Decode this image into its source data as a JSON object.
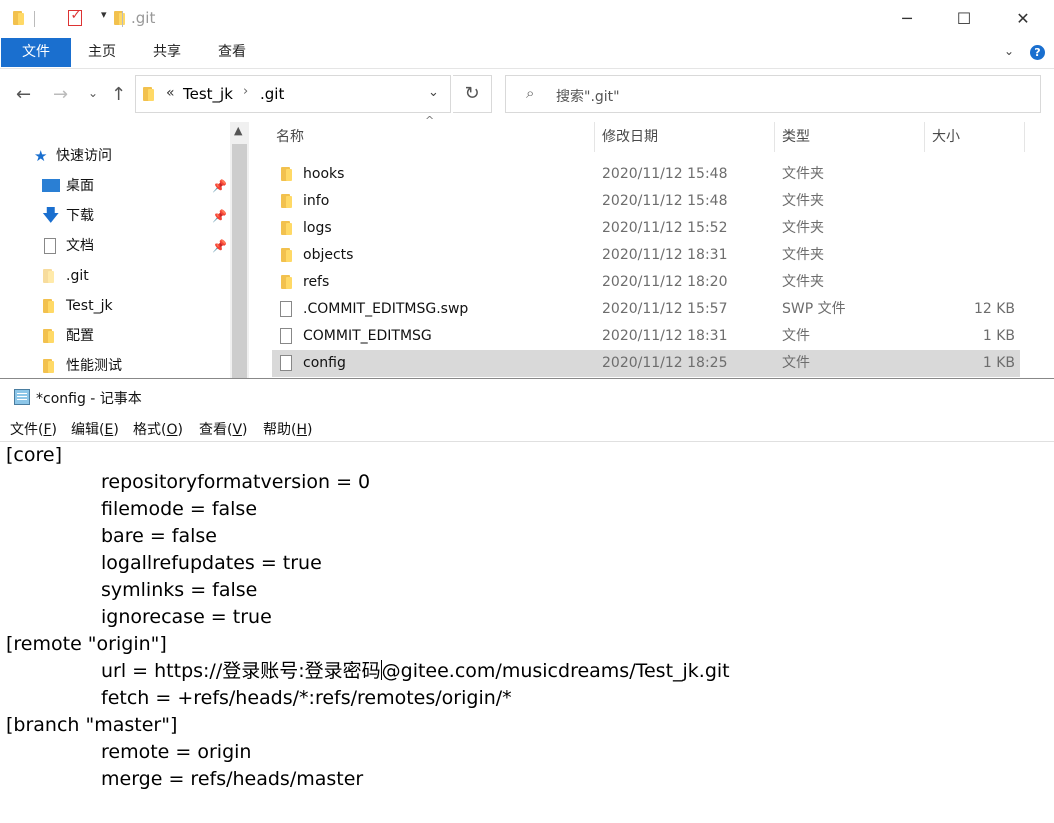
{
  "explorer": {
    "title": ".git",
    "ribbon_tabs": [
      "文件",
      "主页",
      "共享",
      "查看"
    ],
    "breadcrumb": {
      "root_chevron": "«",
      "items": [
        "Test_jk",
        ".git"
      ]
    },
    "search_placeholder": "搜索\".git\"",
    "nav": [
      {
        "label": "快速访问",
        "icon": "star-icon",
        "pinned": false
      },
      {
        "label": "桌面",
        "icon": "desktop-icon",
        "pinned": true
      },
      {
        "label": "下载",
        "icon": "download-arrow-icon",
        "pinned": true
      },
      {
        "label": "文档",
        "icon": "document-icon",
        "pinned": true
      },
      {
        "label": ".git",
        "icon": "folder-icon",
        "pinned": false
      },
      {
        "label": "Test_jk",
        "icon": "folder-icon",
        "pinned": false
      },
      {
        "label": "配置",
        "icon": "folder-icon",
        "pinned": false
      },
      {
        "label": "性能测试",
        "icon": "folder-icon",
        "pinned": false
      }
    ],
    "columns": {
      "name": "名称",
      "date": "修改日期",
      "type": "类型",
      "size": "大小"
    },
    "files": [
      {
        "name": "hooks",
        "date": "2020/11/12 15:48",
        "type": "文件夹",
        "size": "",
        "icon": "folder-icon"
      },
      {
        "name": "info",
        "date": "2020/11/12 15:48",
        "type": "文件夹",
        "size": "",
        "icon": "folder-icon"
      },
      {
        "name": "logs",
        "date": "2020/11/12 15:52",
        "type": "文件夹",
        "size": "",
        "icon": "folder-icon"
      },
      {
        "name": "objects",
        "date": "2020/11/12 18:31",
        "type": "文件夹",
        "size": "",
        "icon": "folder-icon"
      },
      {
        "name": "refs",
        "date": "2020/11/12 18:20",
        "type": "文件夹",
        "size": "",
        "icon": "folder-icon"
      },
      {
        "name": ".COMMIT_EDITMSG.swp",
        "date": "2020/11/12 15:57",
        "type": "SWP 文件",
        "size": "12 KB",
        "icon": "file-icon"
      },
      {
        "name": "COMMIT_EDITMSG",
        "date": "2020/11/12 18:31",
        "type": "文件",
        "size": "1 KB",
        "icon": "file-icon"
      },
      {
        "name": "config",
        "date": "2020/11/12 18:25",
        "type": "文件",
        "size": "1 KB",
        "icon": "file-icon",
        "selected": true
      }
    ]
  },
  "notepad": {
    "title": "*config - 记事本",
    "menus": [
      {
        "label": "文件(",
        "key": "F",
        "end": ")"
      },
      {
        "label": "编辑(",
        "key": "E",
        "end": ")"
      },
      {
        "label": "格式(",
        "key": "O",
        "end": ")"
      },
      {
        "label": "查看(",
        "key": "V",
        "end": ")"
      },
      {
        "label": "帮助(",
        "key": "H",
        "end": ")"
      }
    ],
    "lines": [
      {
        "indent": false,
        "text": "[core]"
      },
      {
        "indent": true,
        "text": "repositoryformatversion = 0"
      },
      {
        "indent": true,
        "text": "filemode = false"
      },
      {
        "indent": true,
        "text": "bare = false"
      },
      {
        "indent": true,
        "text": "logallrefupdates = true"
      },
      {
        "indent": true,
        "text": "symlinks = false"
      },
      {
        "indent": true,
        "text": "ignorecase = true"
      },
      {
        "indent": false,
        "text": "[remote \"origin\"]"
      },
      {
        "indent": true,
        "text": "url = https://登录账号:登录密码",
        "after_caret": "@gitee.com/musicdreams/Test_jk.git"
      },
      {
        "indent": true,
        "text": "fetch = +refs/heads/*:refs/remotes/origin/*"
      },
      {
        "indent": false,
        "text": "[branch \"master\"]"
      },
      {
        "indent": true,
        "text": "remote = origin"
      },
      {
        "indent": true,
        "text": "merge = refs/heads/master"
      }
    ]
  }
}
